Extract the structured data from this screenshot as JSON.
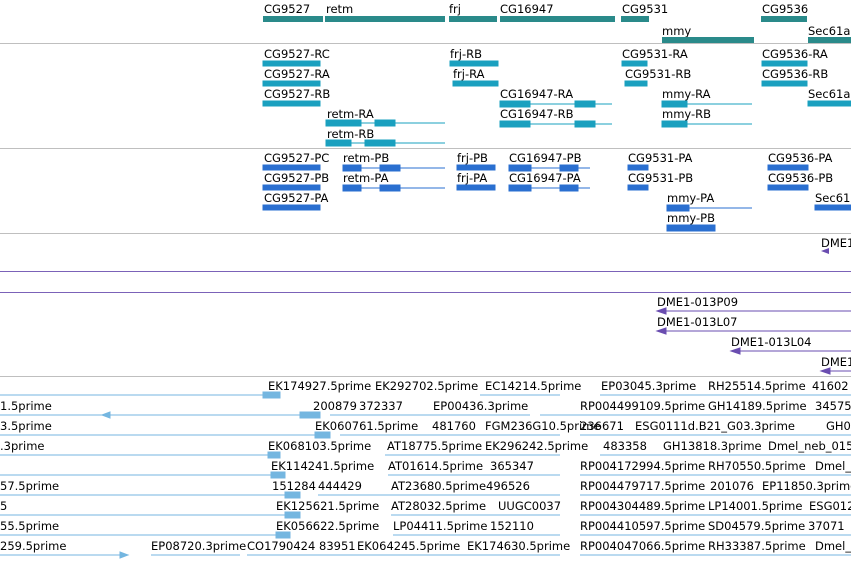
{
  "colors": {
    "gene": "#2a8a8a",
    "transcript": "#1aa0bf",
    "protein": "#2a6fd0",
    "clone": "#6a4db0",
    "est": "#74b6e0",
    "separator": "#bfbfbf",
    "purple_line": "#7b62b8"
  },
  "genes": [
    {
      "label": "CG9527"
    },
    {
      "label": "retm"
    },
    {
      "label": "frj"
    },
    {
      "label": "CG16947"
    },
    {
      "label": "CG9531"
    },
    {
      "label": "mmy"
    },
    {
      "label": "CG9536"
    },
    {
      "label": "Sec61a"
    }
  ],
  "transcripts": [
    {
      "label": "CG9527-RC"
    },
    {
      "label": "CG9527-RA"
    },
    {
      "label": "CG9527-RB"
    },
    {
      "label": "retm-RA"
    },
    {
      "label": "retm-RB"
    },
    {
      "label": "frj-RB"
    },
    {
      "label": "frj-RA"
    },
    {
      "label": "CG16947-RA"
    },
    {
      "label": "CG16947-RB"
    },
    {
      "label": "CG9531-RA"
    },
    {
      "label": "CG9531-RB"
    },
    {
      "label": "mmy-RA"
    },
    {
      "label": "mmy-RB"
    },
    {
      "label": "CG9536-RA"
    },
    {
      "label": "CG9536-RB"
    },
    {
      "label": "Sec61a"
    }
  ],
  "proteins": [
    {
      "label": "CG9527-PC"
    },
    {
      "label": "CG9527-PB"
    },
    {
      "label": "CG9527-PA"
    },
    {
      "label": "retm-PB"
    },
    {
      "label": "retm-PA"
    },
    {
      "label": "frj-PB"
    },
    {
      "label": "frj-PA"
    },
    {
      "label": "CG16947-PB"
    },
    {
      "label": "CG16947-PA"
    },
    {
      "label": "CG9531-PA"
    },
    {
      "label": "CG9531-PB"
    },
    {
      "label": "mmy-PA"
    },
    {
      "label": "mmy-PB"
    },
    {
      "label": "CG9536-PA"
    },
    {
      "label": "CG9536-PB"
    },
    {
      "label": "Sec61"
    }
  ],
  "clones_top": [
    {
      "label": "DME1"
    }
  ],
  "clones": [
    {
      "label": "DME1-013P09"
    },
    {
      "label": "DME1-013L07"
    },
    {
      "label": "DME1-013L04"
    },
    {
      "label": "DME1"
    }
  ],
  "ests": [
    {
      "label": "EK174927.5prime"
    },
    {
      "label": "EK292702.5prime"
    },
    {
      "label": "EC14214.5prime"
    },
    {
      "label": "EP03045.3prime"
    },
    {
      "label": "RH25514.5prime"
    },
    {
      "label": "41602"
    },
    {
      "label": "1.5prime"
    },
    {
      "label": "200879"
    },
    {
      "label": "372337"
    },
    {
      "label": "EP00436.3prime"
    },
    {
      "label": "RP004499109.5prime"
    },
    {
      "label": "GH14189.5prime"
    },
    {
      "label": "34575"
    },
    {
      "label": "3.5prime"
    },
    {
      "label": "EK060761.5prime"
    },
    {
      "label": "481760"
    },
    {
      "label": "FGM236G10.5prime"
    },
    {
      "label": "236671"
    },
    {
      "label": "ESG0111d.B21_G03.3prime"
    },
    {
      "label": "GH0"
    },
    {
      "label": ".3prime"
    },
    {
      "label": "EK068103.5prime"
    },
    {
      "label": "AT18775.5prime"
    },
    {
      "label": "EK296242.5prime"
    },
    {
      "label": "483358"
    },
    {
      "label": "GH13818.3prime"
    },
    {
      "label": "Dmel_neb_015"
    },
    {
      "label": "EK114241.5prime"
    },
    {
      "label": "AT01614.5prime"
    },
    {
      "label": "365347"
    },
    {
      "label": "RP004172994.5prime"
    },
    {
      "label": "RH70550.5prime"
    },
    {
      "label": "Dmel_n"
    },
    {
      "label": "57.5prime"
    },
    {
      "label": "151284"
    },
    {
      "label": "444429"
    },
    {
      "label": "AT23680.5prime"
    },
    {
      "label": "496526"
    },
    {
      "label": "RP004479717.5prime"
    },
    {
      "label": "201076"
    },
    {
      "label": "EP11850.3prime"
    },
    {
      "label": "5"
    },
    {
      "label": "EK125621.5prime"
    },
    {
      "label": "AT28032.5prime"
    },
    {
      "label": "UUGC0037"
    },
    {
      "label": "RP004304489.5prime"
    },
    {
      "label": "LP14001.5prime"
    },
    {
      "label": "ESG012"
    },
    {
      "label": "55.5prime"
    },
    {
      "label": "EK056622.5prime"
    },
    {
      "label": "LP04411.5prime"
    },
    {
      "label": "152110"
    },
    {
      "label": "RP004410597.5prime"
    },
    {
      "label": "SD04579.5prime"
    },
    {
      "label": "37071"
    },
    {
      "label": "259.5prime"
    },
    {
      "label": "EP08720.3prime"
    },
    {
      "label": "CO1790424"
    },
    {
      "label": "83951"
    },
    {
      "label": "EK064245.5prime"
    },
    {
      "label": "EK174630.5prime"
    },
    {
      "label": "RP004047066.5prime"
    },
    {
      "label": "RH33387.5prime"
    },
    {
      "label": "Dmel_n"
    }
  ]
}
